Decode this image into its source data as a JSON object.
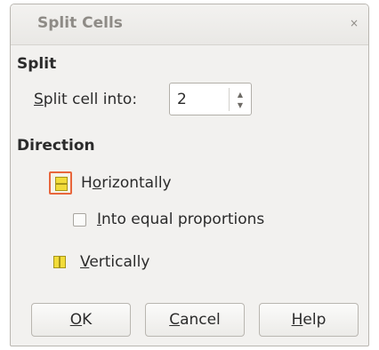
{
  "dialog": {
    "title": "Split Cells",
    "close_symbol": "×"
  },
  "split": {
    "section_title": "Split",
    "split_into": {
      "mnemonic": "S",
      "rest": "plit cell into:"
    },
    "value": "2",
    "up_symbol": "▲",
    "down_symbol": "▼"
  },
  "direction": {
    "section_title": "Direction",
    "horizontally": {
      "before": "H",
      "mnemonic": "o",
      "after": "rizontally",
      "selected": true
    },
    "equal_proportions": {
      "mnemonic": "I",
      "rest": "nto equal proportions",
      "checked": false
    },
    "vertically": {
      "mnemonic": "V",
      "rest": "ertically",
      "selected": false
    }
  },
  "buttons": {
    "ok": {
      "mnemonic": "O",
      "rest": "K"
    },
    "cancel": {
      "mnemonic": "C",
      "rest": "ancel"
    },
    "help": {
      "mnemonic": "H",
      "rest": "elp"
    }
  },
  "icons": {
    "horizontal_split": "split-horizontal-icon",
    "vertical_split": "split-vertical-icon"
  },
  "colors": {
    "selected_border": "#e8663c",
    "icon_fill": "#f2dc3a"
  }
}
